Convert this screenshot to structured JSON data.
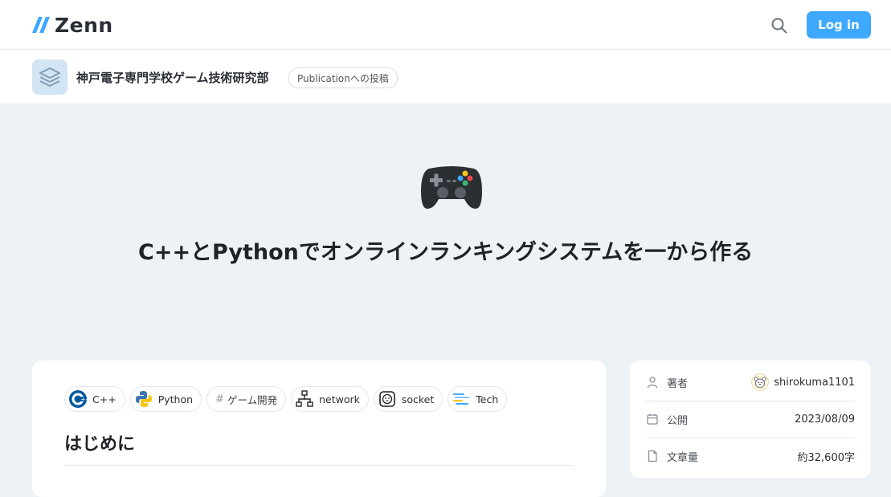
{
  "header": {
    "logo_text": "Zenn",
    "login_label": "Log in",
    "icons": {
      "logo": "zenn-logo-icon",
      "search": "search-icon"
    },
    "accent_color": "#3ea8ff"
  },
  "publication": {
    "name": "神戸電子専門学校ゲーム技術研究部",
    "badge": "Publicationへの投稿",
    "icon": "layers-icon"
  },
  "article": {
    "emoji": "game-controller-icon",
    "title": "C++とPythonでオンラインランキングシステムを一から作る",
    "tags": [
      {
        "label": "C++",
        "icon": "cpp-logo-icon"
      },
      {
        "label": "Python",
        "icon": "python-logo-icon"
      },
      {
        "label": "ゲーム開発",
        "icon": "hash-icon"
      },
      {
        "label": "network",
        "icon": "network-icon"
      },
      {
        "label": "socket",
        "icon": "socket-icon"
      },
      {
        "label": "Tech",
        "icon": "tech-icon"
      }
    ],
    "first_heading": "はじめに"
  },
  "info": {
    "author_label": "著者",
    "author_name": "shirokuma1101",
    "published_label": "公開",
    "published_date": "2023/08/09",
    "length_label": "文章量",
    "length_value": "約32,600字"
  }
}
